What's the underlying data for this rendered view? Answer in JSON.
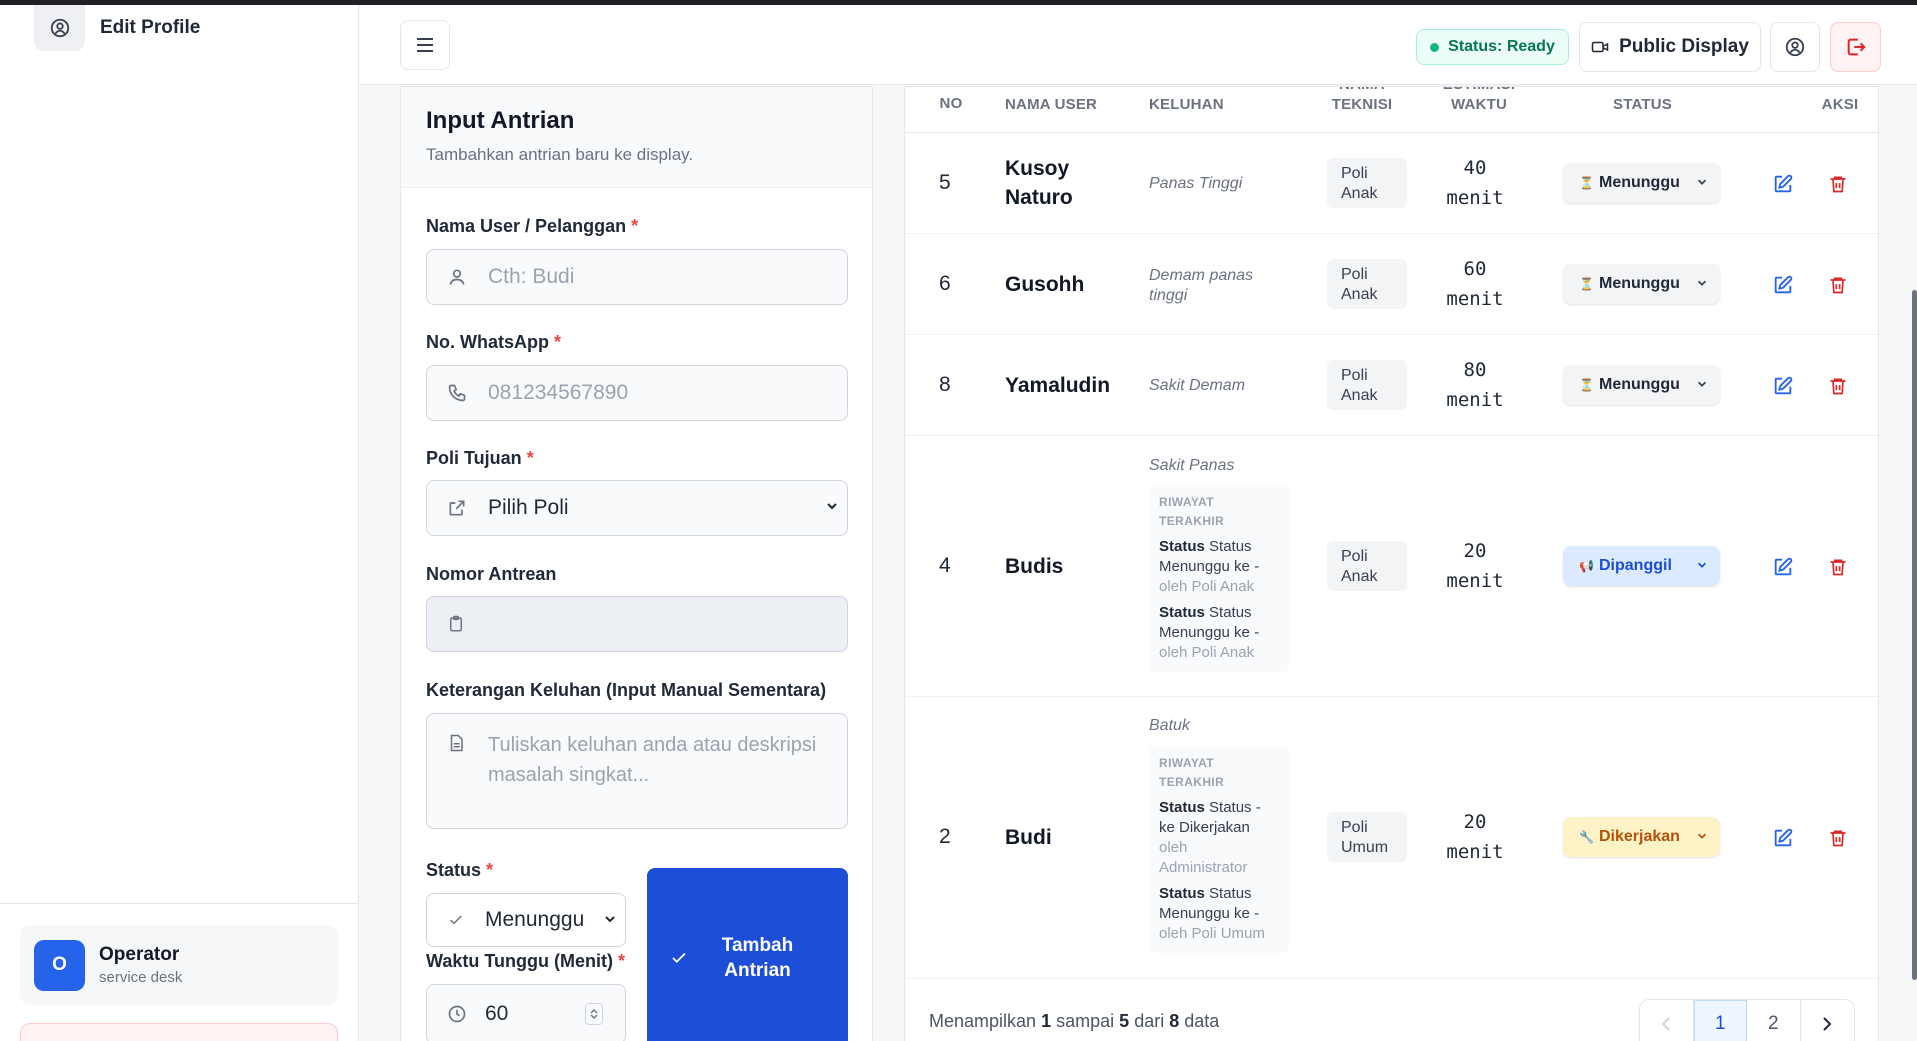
{
  "sidebar": {
    "edit_profile": "Edit Profile",
    "user": {
      "avatar_letter": "O",
      "name": "Operator",
      "role": "service desk"
    }
  },
  "header": {
    "status": "Status: Ready",
    "public_display": "Public Display"
  },
  "form": {
    "title": "Input Antrian",
    "subtitle": "Tambahkan antrian baru ke display.",
    "name_label": "Nama User / Pelanggan",
    "name_placeholder": "Cth: Budi",
    "wa_label": "No. WhatsApp",
    "wa_placeholder": "081234567890",
    "poli_label": "Poli Tujuan",
    "poli_value": "Pilih Poli",
    "nomor_label": "Nomor Antrean",
    "keluhan_label": "Keterangan Keluhan (Input Manual Sementara)",
    "keluhan_placeholder": "Tuliskan keluhan anda atau deskripsi masalah singkat...",
    "status_label": "Status",
    "status_value": "Menunggu",
    "wait_label": "Waktu Tunggu (Menit)",
    "wait_value": "60",
    "required_mark": "*",
    "submit_label": "Tambah Antrian"
  },
  "table": {
    "headers": {
      "no": "NO",
      "name": "NAMA USER",
      "keluhan": "KELUHAN",
      "teknisi": "NAMA TEKNISI",
      "estimasi": "ESTIMASI WAKTU",
      "status": "STATUS",
      "aksi": "AKSI"
    },
    "history_title": "RIWAYAT TERAKHIR",
    "rows": [
      {
        "no": "5",
        "name": "Kusoy Naturo",
        "keluhan": "Panas Tinggi",
        "poli": "Poli Anak",
        "est_num": "40",
        "est_unit": "menit",
        "status": "Menunggu",
        "status_icon": "⏳"
      },
      {
        "no": "6",
        "name": "Gusohh",
        "keluhan": "Demam panas tinggi",
        "poli": "Poli Anak",
        "est_num": "60",
        "est_unit": "menit",
        "status": "Menunggu",
        "status_icon": "⏳"
      },
      {
        "no": "8",
        "name": "Yamaludin",
        "keluhan": "Sakit Demam",
        "poli": "Poli Anak",
        "est_num": "80",
        "est_unit": "menit",
        "status": "Menunggu",
        "status_icon": "⏳"
      },
      {
        "no": "4",
        "name": "Budis",
        "keluhan": "Sakit Panas",
        "poli": "Poli Anak",
        "est_num": "20",
        "est_unit": "menit",
        "status": "Dipanggil",
        "status_icon": "📢",
        "history": [
          {
            "bold": "Status",
            "text": "Status Menunggu ke -",
            "muted": "oleh Poli Anak"
          },
          {
            "bold": "Status",
            "text": "Status Menunggu ke -",
            "muted": "oleh Poli Anak"
          }
        ]
      },
      {
        "no": "2",
        "name": "Budi",
        "keluhan": "Batuk",
        "poli": "Poli Umum",
        "est_num": "20",
        "est_unit": "menit",
        "status": "Dikerjakan",
        "status_icon": "🔧",
        "history": [
          {
            "bold": "Status",
            "text": "Status - ke Dikerjakan",
            "muted": "oleh Administrator"
          },
          {
            "bold": "Status",
            "text": "Status Menunggu ke -",
            "muted": "oleh Poli Umum"
          }
        ]
      }
    ],
    "footer": {
      "prefix": "Menampilkan",
      "from": "1",
      "mid1": "sampai",
      "to": "5",
      "mid2": "dari",
      "total": "8",
      "suffix": "data"
    },
    "pages": [
      "1",
      "2"
    ]
  },
  "colors": {
    "primary": "#1d4ed8",
    "ready": "#047857",
    "danger": "#dc2626",
    "waiting_bg": "#f3f4f6",
    "called_bg": "#dbeafe",
    "working_bg": "#fef3c7"
  }
}
